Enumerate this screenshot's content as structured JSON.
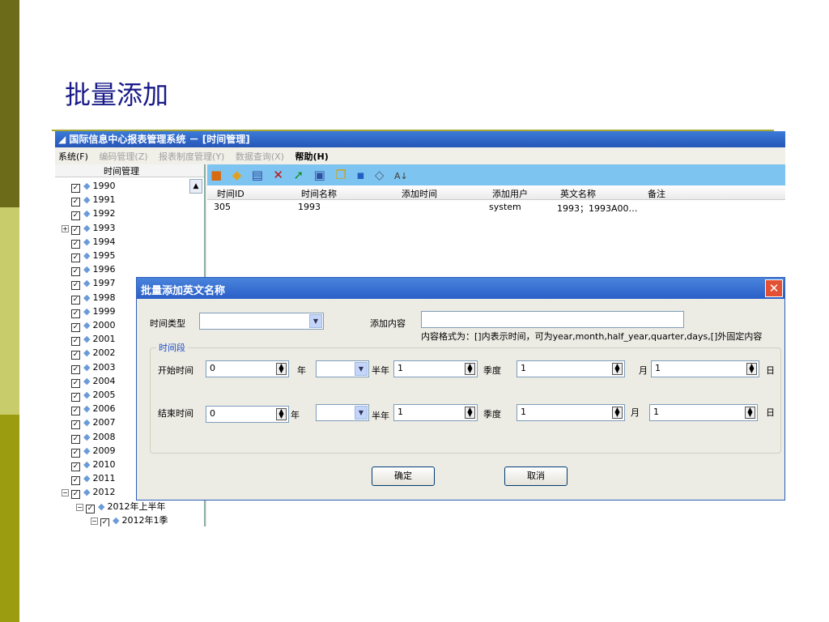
{
  "slide": {
    "title": "批量添加"
  },
  "app": {
    "title": "国际信息中心报表管理系统 － [时间管理]",
    "menu": [
      "系统(F)",
      "编码管理(Z)",
      "报表制度管理(Y)",
      "数据查询(X)",
      "帮助(H)"
    ]
  },
  "tree": {
    "header": "时间管理",
    "items": [
      "1990",
      "1991",
      "1992",
      "1993",
      "1994",
      "1995",
      "1996",
      "1997",
      "1998",
      "1999",
      "2000",
      "2001",
      "2002",
      "2003",
      "2004",
      "2005",
      "2006",
      "2007",
      "2008",
      "2009",
      "2010",
      "2011",
      "2012",
      "2012年上半年",
      "2012年1季"
    ]
  },
  "grid": {
    "columns": [
      "时间ID",
      "时间名称",
      "添加时间",
      "添加用户",
      "英文名称",
      "备注"
    ],
    "rows": [
      [
        "305",
        "1993",
        "",
        "system",
        "1993；1993A00…",
        ""
      ]
    ]
  },
  "dialog": {
    "title": "批量添加英文名称",
    "time_type_label": "时间类型",
    "time_type_value": "",
    "add_content_label": "添加内容",
    "add_content_value": "",
    "hint": "内容格式为：[]内表示时间，可为year,month,half_year,quarter,days,[]外固定内容",
    "group_label": "时间段",
    "start_label": "开始时间",
    "end_label": "结束时间",
    "year_unit": "年",
    "half_unit": "半年",
    "quarter_unit": "季度",
    "month_unit": "月",
    "day_unit": "日",
    "start": {
      "year": "0",
      "half": "",
      "quarter": "1",
      "month": "1",
      "day": "1"
    },
    "end": {
      "year": "0",
      "half": "",
      "quarter": "1",
      "month": "1",
      "day": "1"
    },
    "ok": "确定",
    "cancel": "取消"
  }
}
